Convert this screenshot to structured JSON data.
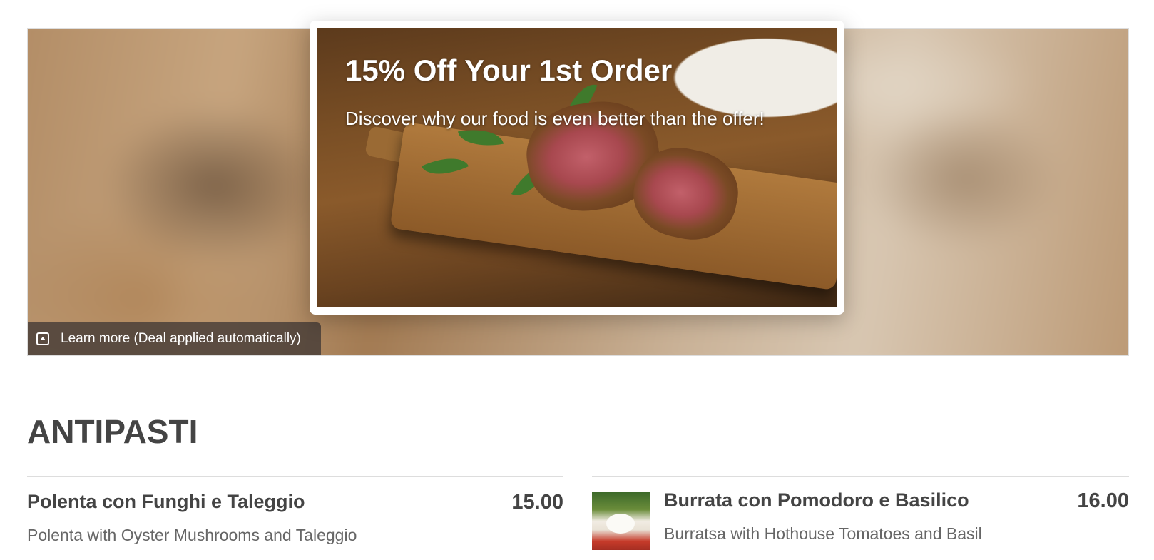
{
  "hero": {
    "learn_more_label": "Learn more (Deal applied automatically)",
    "learn_more_icon": "chevron-up-square-icon"
  },
  "promo": {
    "title": "15% Off Your 1st Order",
    "subtitle": "Discover why our food is even better than the offer!"
  },
  "menu": {
    "section_title": "ANTIPASTI",
    "items": [
      {
        "name": "Polenta con Funghi e Taleggio",
        "price": "15.00",
        "description": "Polenta with Oyster Mushrooms and Taleggio"
      },
      {
        "name": "Burrata con Pomodoro e Basilico",
        "price": "16.00",
        "description": "Burratsa with Hothouse Tomatoes and Basil"
      }
    ]
  }
}
